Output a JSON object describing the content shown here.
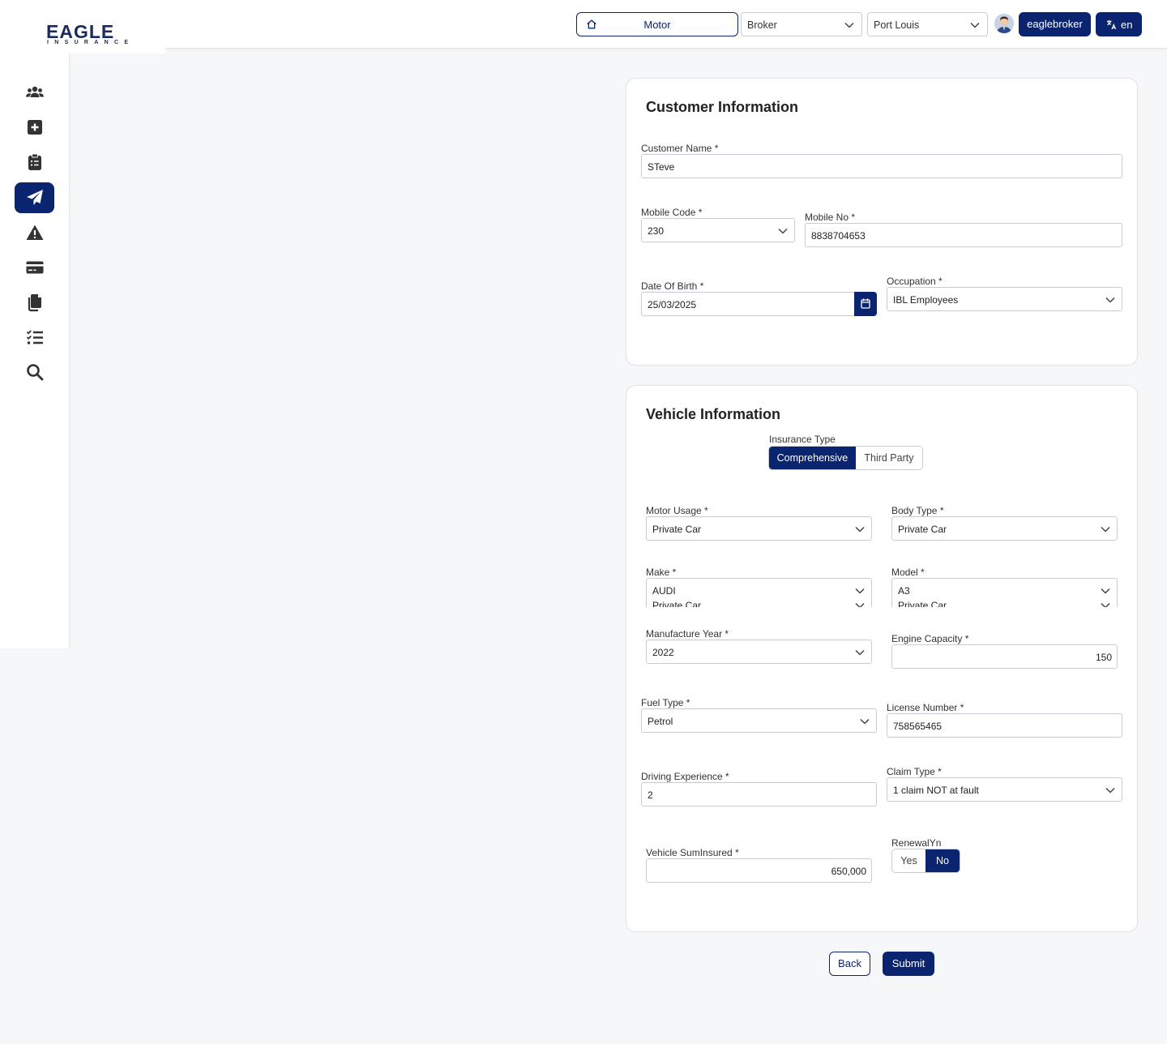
{
  "header": {
    "logo_text": "EAGLE",
    "logo_sub": "INSURANCE",
    "product_label": "Motor",
    "user_type": "Broker",
    "branch": "Port Louis",
    "username": "eaglebroker",
    "language": "en",
    "accent": "#0b2470"
  },
  "sidebar": {
    "items": [
      {
        "icon": "users-icon"
      },
      {
        "icon": "plus-square-icon"
      },
      {
        "icon": "clipboard-list-icon"
      },
      {
        "icon": "paper-plane-icon",
        "active": true
      },
      {
        "icon": "warning-icon"
      },
      {
        "icon": "credit-card-icon"
      },
      {
        "icon": "copy-icon"
      },
      {
        "icon": "checklist-icon"
      },
      {
        "icon": "search-icon"
      }
    ]
  },
  "customer": {
    "title": "Customer Information",
    "name_label": "Customer Name *",
    "name_value": "STeve",
    "mobile_code_label": "Mobile Code *",
    "mobile_code_value": "230",
    "mobile_no_label": "Mobile No *",
    "mobile_no_value": "8838704653",
    "dob_label": "Date Of Birth *",
    "dob_value": "25/03/2025",
    "occupation_label": "Occupation *",
    "occupation_value": "IBL Employees"
  },
  "vehicle": {
    "title": "Vehicle Information",
    "insurance_type_label": "Insurance Type",
    "insurance_type_options": [
      "Comprehensive",
      "Third Party"
    ],
    "insurance_type_selected": "Comprehensive",
    "motor_usage_label": "Motor Usage *",
    "motor_usage_value": "Private Car",
    "body_type_label": "Body Type *",
    "body_type_value": "Private Car",
    "make_label": "Make *",
    "make_value": "AUDI",
    "make_second": "Private Car",
    "model_label": "Model *",
    "model_value": "A3",
    "model_second": "Private Car",
    "year_label": "Manufacture Year *",
    "year_value": "2022",
    "engine_label": "Engine Capacity *",
    "engine_value": "150",
    "fuel_label": "Fuel Type *",
    "fuel_value": "Petrol",
    "license_label": "License Number *",
    "license_value": "758565465",
    "experience_label": "Driving Experience *",
    "experience_value": "2",
    "claim_label": "Claim Type *",
    "claim_value": "1 claim NOT at fault",
    "suminsured_label": "Vehicle SumInsured *",
    "suminsured_value": "650,000",
    "renewal_label": "RenewalYn",
    "renewal_options": [
      "Yes",
      "No"
    ],
    "renewal_selected": "No"
  },
  "actions": {
    "back_label": "Back",
    "submit_label": "Submit"
  }
}
